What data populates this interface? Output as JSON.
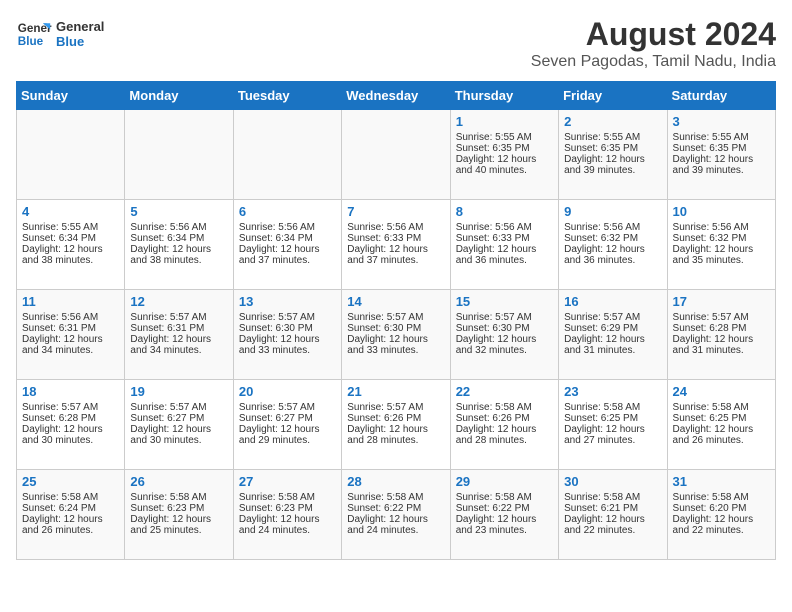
{
  "header": {
    "logo_line1": "General",
    "logo_line2": "Blue",
    "month_year": "August 2024",
    "location": "Seven Pagodas, Tamil Nadu, India"
  },
  "days_of_week": [
    "Sunday",
    "Monday",
    "Tuesday",
    "Wednesday",
    "Thursday",
    "Friday",
    "Saturday"
  ],
  "weeks": [
    [
      {
        "day": "",
        "lines": []
      },
      {
        "day": "",
        "lines": []
      },
      {
        "day": "",
        "lines": []
      },
      {
        "day": "",
        "lines": []
      },
      {
        "day": "1",
        "lines": [
          "Sunrise: 5:55 AM",
          "Sunset: 6:35 PM",
          "Daylight: 12 hours",
          "and 40 minutes."
        ]
      },
      {
        "day": "2",
        "lines": [
          "Sunrise: 5:55 AM",
          "Sunset: 6:35 PM",
          "Daylight: 12 hours",
          "and 39 minutes."
        ]
      },
      {
        "day": "3",
        "lines": [
          "Sunrise: 5:55 AM",
          "Sunset: 6:35 PM",
          "Daylight: 12 hours",
          "and 39 minutes."
        ]
      }
    ],
    [
      {
        "day": "4",
        "lines": [
          "Sunrise: 5:55 AM",
          "Sunset: 6:34 PM",
          "Daylight: 12 hours",
          "and 38 minutes."
        ]
      },
      {
        "day": "5",
        "lines": [
          "Sunrise: 5:56 AM",
          "Sunset: 6:34 PM",
          "Daylight: 12 hours",
          "and 38 minutes."
        ]
      },
      {
        "day": "6",
        "lines": [
          "Sunrise: 5:56 AM",
          "Sunset: 6:34 PM",
          "Daylight: 12 hours",
          "and 37 minutes."
        ]
      },
      {
        "day": "7",
        "lines": [
          "Sunrise: 5:56 AM",
          "Sunset: 6:33 PM",
          "Daylight: 12 hours",
          "and 37 minutes."
        ]
      },
      {
        "day": "8",
        "lines": [
          "Sunrise: 5:56 AM",
          "Sunset: 6:33 PM",
          "Daylight: 12 hours",
          "and 36 minutes."
        ]
      },
      {
        "day": "9",
        "lines": [
          "Sunrise: 5:56 AM",
          "Sunset: 6:32 PM",
          "Daylight: 12 hours",
          "and 36 minutes."
        ]
      },
      {
        "day": "10",
        "lines": [
          "Sunrise: 5:56 AM",
          "Sunset: 6:32 PM",
          "Daylight: 12 hours",
          "and 35 minutes."
        ]
      }
    ],
    [
      {
        "day": "11",
        "lines": [
          "Sunrise: 5:56 AM",
          "Sunset: 6:31 PM",
          "Daylight: 12 hours",
          "and 34 minutes."
        ]
      },
      {
        "day": "12",
        "lines": [
          "Sunrise: 5:57 AM",
          "Sunset: 6:31 PM",
          "Daylight: 12 hours",
          "and 34 minutes."
        ]
      },
      {
        "day": "13",
        "lines": [
          "Sunrise: 5:57 AM",
          "Sunset: 6:30 PM",
          "Daylight: 12 hours",
          "and 33 minutes."
        ]
      },
      {
        "day": "14",
        "lines": [
          "Sunrise: 5:57 AM",
          "Sunset: 6:30 PM",
          "Daylight: 12 hours",
          "and 33 minutes."
        ]
      },
      {
        "day": "15",
        "lines": [
          "Sunrise: 5:57 AM",
          "Sunset: 6:30 PM",
          "Daylight: 12 hours",
          "and 32 minutes."
        ]
      },
      {
        "day": "16",
        "lines": [
          "Sunrise: 5:57 AM",
          "Sunset: 6:29 PM",
          "Daylight: 12 hours",
          "and 31 minutes."
        ]
      },
      {
        "day": "17",
        "lines": [
          "Sunrise: 5:57 AM",
          "Sunset: 6:28 PM",
          "Daylight: 12 hours",
          "and 31 minutes."
        ]
      }
    ],
    [
      {
        "day": "18",
        "lines": [
          "Sunrise: 5:57 AM",
          "Sunset: 6:28 PM",
          "Daylight: 12 hours",
          "and 30 minutes."
        ]
      },
      {
        "day": "19",
        "lines": [
          "Sunrise: 5:57 AM",
          "Sunset: 6:27 PM",
          "Daylight: 12 hours",
          "and 30 minutes."
        ]
      },
      {
        "day": "20",
        "lines": [
          "Sunrise: 5:57 AM",
          "Sunset: 6:27 PM",
          "Daylight: 12 hours",
          "and 29 minutes."
        ]
      },
      {
        "day": "21",
        "lines": [
          "Sunrise: 5:57 AM",
          "Sunset: 6:26 PM",
          "Daylight: 12 hours",
          "and 28 minutes."
        ]
      },
      {
        "day": "22",
        "lines": [
          "Sunrise: 5:58 AM",
          "Sunset: 6:26 PM",
          "Daylight: 12 hours",
          "and 28 minutes."
        ]
      },
      {
        "day": "23",
        "lines": [
          "Sunrise: 5:58 AM",
          "Sunset: 6:25 PM",
          "Daylight: 12 hours",
          "and 27 minutes."
        ]
      },
      {
        "day": "24",
        "lines": [
          "Sunrise: 5:58 AM",
          "Sunset: 6:25 PM",
          "Daylight: 12 hours",
          "and 26 minutes."
        ]
      }
    ],
    [
      {
        "day": "25",
        "lines": [
          "Sunrise: 5:58 AM",
          "Sunset: 6:24 PM",
          "Daylight: 12 hours",
          "and 26 minutes."
        ]
      },
      {
        "day": "26",
        "lines": [
          "Sunrise: 5:58 AM",
          "Sunset: 6:23 PM",
          "Daylight: 12 hours",
          "and 25 minutes."
        ]
      },
      {
        "day": "27",
        "lines": [
          "Sunrise: 5:58 AM",
          "Sunset: 6:23 PM",
          "Daylight: 12 hours",
          "and 24 minutes."
        ]
      },
      {
        "day": "28",
        "lines": [
          "Sunrise: 5:58 AM",
          "Sunset: 6:22 PM",
          "Daylight: 12 hours",
          "and 24 minutes."
        ]
      },
      {
        "day": "29",
        "lines": [
          "Sunrise: 5:58 AM",
          "Sunset: 6:22 PM",
          "Daylight: 12 hours",
          "and 23 minutes."
        ]
      },
      {
        "day": "30",
        "lines": [
          "Sunrise: 5:58 AM",
          "Sunset: 6:21 PM",
          "Daylight: 12 hours",
          "and 22 minutes."
        ]
      },
      {
        "day": "31",
        "lines": [
          "Sunrise: 5:58 AM",
          "Sunset: 6:20 PM",
          "Daylight: 12 hours",
          "and 22 minutes."
        ]
      }
    ]
  ]
}
